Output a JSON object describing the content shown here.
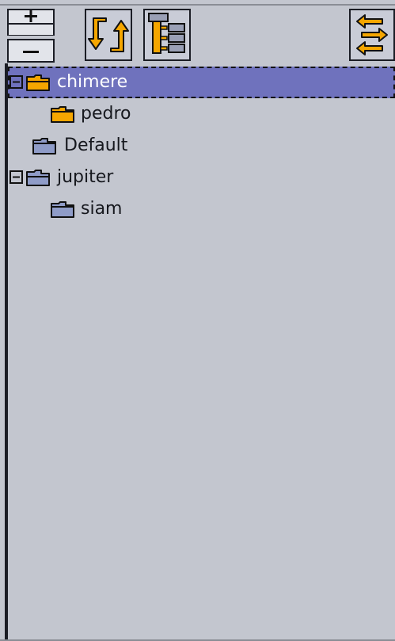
{
  "toolbar": {
    "zoom_in_icon": "plus-icon",
    "zoom_out_icon": "minus-icon",
    "swap_icon": "swap-arrows-icon",
    "tree_view_icon": "tree-view-icon",
    "collapse_icon": "collapse-arrows-icon"
  },
  "tree": {
    "items": [
      {
        "label": "chimere",
        "depth": 0,
        "expanded": true,
        "selected": true,
        "folder_color": "#f5a600"
      },
      {
        "label": "pedro",
        "depth": 1,
        "expanded": null,
        "selected": false,
        "folder_color": "#f5a600"
      },
      {
        "label": "Default",
        "depth": 0,
        "expanded": null,
        "selected": false,
        "folder_color": "#8f9cc8"
      },
      {
        "label": "jupiter",
        "depth": 0,
        "expanded": true,
        "selected": false,
        "folder_color": "#8f9cc8"
      },
      {
        "label": "siam",
        "depth": 1,
        "expanded": null,
        "selected": false,
        "folder_color": "#8f9cc8"
      }
    ]
  },
  "colors": {
    "background": "#c3c6cf",
    "selection": "#6f72bd",
    "accent_orange": "#f5a600",
    "folder_blue": "#8f9cc8"
  }
}
